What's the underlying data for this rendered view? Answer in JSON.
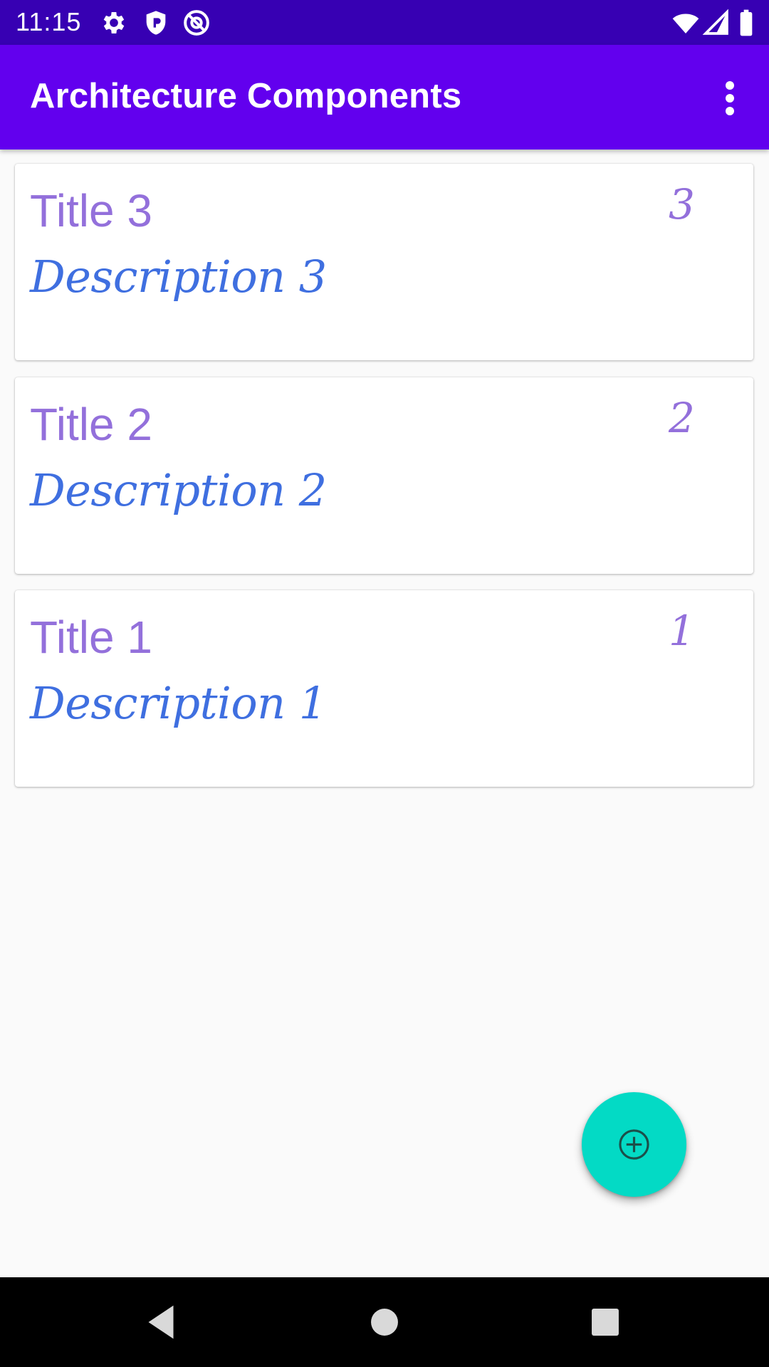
{
  "status_bar": {
    "time": "11:15",
    "left_icons": [
      "settings-icon",
      "shield-icon",
      "at-sign-icon"
    ],
    "right_icons": [
      "wifi-icon",
      "cell-signal-icon",
      "battery-icon"
    ]
  },
  "app_bar": {
    "title": "Architecture Components",
    "overflow_icon": "more-vert-icon"
  },
  "notes": [
    {
      "title": "Title 3",
      "description": "Description 3",
      "priority": "3"
    },
    {
      "title": "Title 2",
      "description": "Description 2",
      "priority": "2"
    },
    {
      "title": "Title 1",
      "description": "Description 1",
      "priority": "1"
    }
  ],
  "fab": {
    "icon": "add-circle-icon"
  },
  "nav_bar": {
    "icons": [
      "back-icon",
      "home-icon",
      "recents-icon"
    ]
  },
  "colors": {
    "status_bar": "#3700b3",
    "app_bar": "#6200ee",
    "title_text": "#9370db",
    "description_text": "#3f6fe0",
    "fab": "#03dac5",
    "background": "#fafafa"
  }
}
